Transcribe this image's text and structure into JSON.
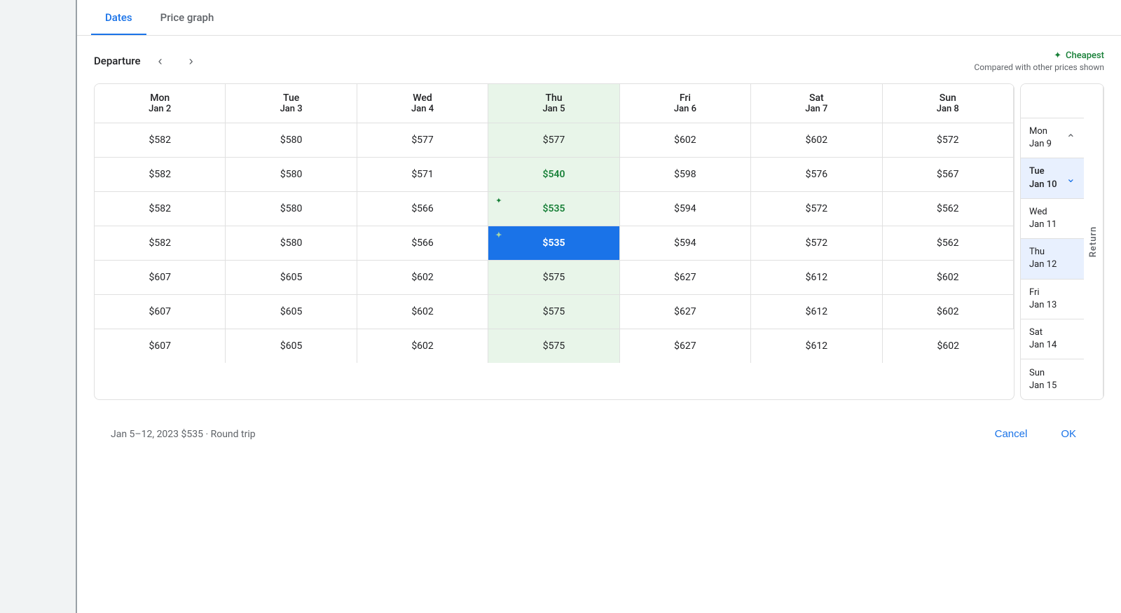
{
  "tabs": {
    "dates": "Dates",
    "price_graph": "Price graph"
  },
  "header": {
    "departure_label": "Departure",
    "cheapest_label": "✦ Cheapest",
    "cheapest_sub": "Compared with other prices shown"
  },
  "columns": [
    {
      "day": "Mon",
      "date": "Jan 2"
    },
    {
      "day": "Tue",
      "date": "Jan 3"
    },
    {
      "day": "Wed",
      "date": "Jan 4"
    },
    {
      "day": "Thu",
      "date": "Jan 5"
    },
    {
      "day": "Fri",
      "date": "Jan 6"
    },
    {
      "day": "Sat",
      "date": "Jan 7"
    },
    {
      "day": "Sun",
      "date": "Jan 8"
    }
  ],
  "rows": [
    {
      "return": "Mon\nJan 9",
      "cells": [
        "$582",
        "$580",
        "$577",
        "$577",
        "$602",
        "$602",
        "$572"
      ],
      "thu_cheap": false,
      "thu_selected": false
    },
    {
      "return": "Tue\nJan 10",
      "cells": [
        "$582",
        "$580",
        "$571",
        "$540",
        "$598",
        "$576",
        "$567"
      ],
      "thu_cheap": true,
      "thu_selected": false
    },
    {
      "return": "Wed\nJan 11",
      "cells": [
        "$582",
        "$580",
        "$566",
        "$535",
        "$594",
        "$572",
        "$562"
      ],
      "thu_cheap": false,
      "thu_selected": false,
      "thu_cheapest_star": true
    },
    {
      "return": "Thu\nJan 12",
      "cells": [
        "$582",
        "$580",
        "$566",
        "$535",
        "$594",
        "$572",
        "$562"
      ],
      "thu_cheap": false,
      "thu_selected": true,
      "thu_cheapest_star": true
    },
    {
      "return": "Fri\nJan 13",
      "cells": [
        "$607",
        "$605",
        "$602",
        "$575",
        "$627",
        "$612",
        "$602"
      ],
      "thu_cheap": false,
      "thu_selected": false
    },
    {
      "return": "Sat\nJan 14",
      "cells": [
        "$607",
        "$605",
        "$602",
        "$575",
        "$627",
        "$612",
        "$602"
      ],
      "thu_cheap": false,
      "thu_selected": false
    },
    {
      "return": "Sun\nJan 15",
      "cells": [
        "$607",
        "$605",
        "$602",
        "$575",
        "$627",
        "$612",
        "$602"
      ],
      "thu_cheap": false,
      "thu_selected": false
    }
  ],
  "return_label": "Return",
  "bottom": {
    "trip_info": "Jan 5–12, 2023  $535 · Round trip",
    "cancel": "Cancel",
    "ok": "OK"
  }
}
